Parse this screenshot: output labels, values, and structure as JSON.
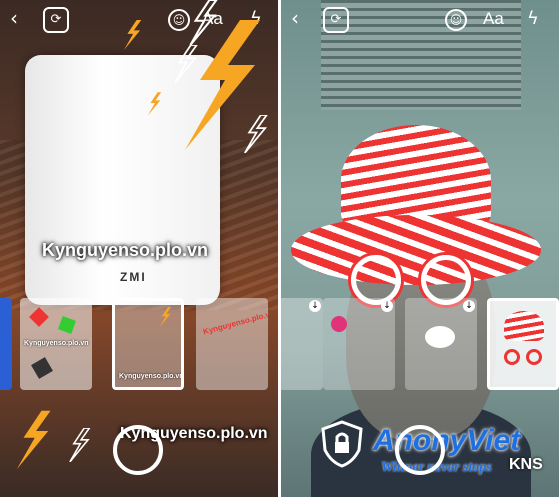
{
  "left_screen": {
    "watermark_top": "Kynguyenso.plo.vn",
    "product_logo": "ZMI",
    "watermark_bottom": "Kynguyenso.plo.vn",
    "thumb_watermark_1": "Kynguyenso.plo.vn",
    "thumb_watermark_2": "Kynguyenso.plo.vn",
    "thumb_watermark_3": "Kynguyenso.plo.vn"
  },
  "right_screen": {
    "aa_label": "Aa",
    "brand_name": "AnonyViet",
    "brand_slogan": "Winner never stops",
    "brand_short": "KNS"
  },
  "toolbar": {
    "aa_label": "Aa"
  },
  "colors": {
    "bolt": "#f6a623",
    "hat_red": "#e33333",
    "brand_blue": "#1e6fe0"
  }
}
